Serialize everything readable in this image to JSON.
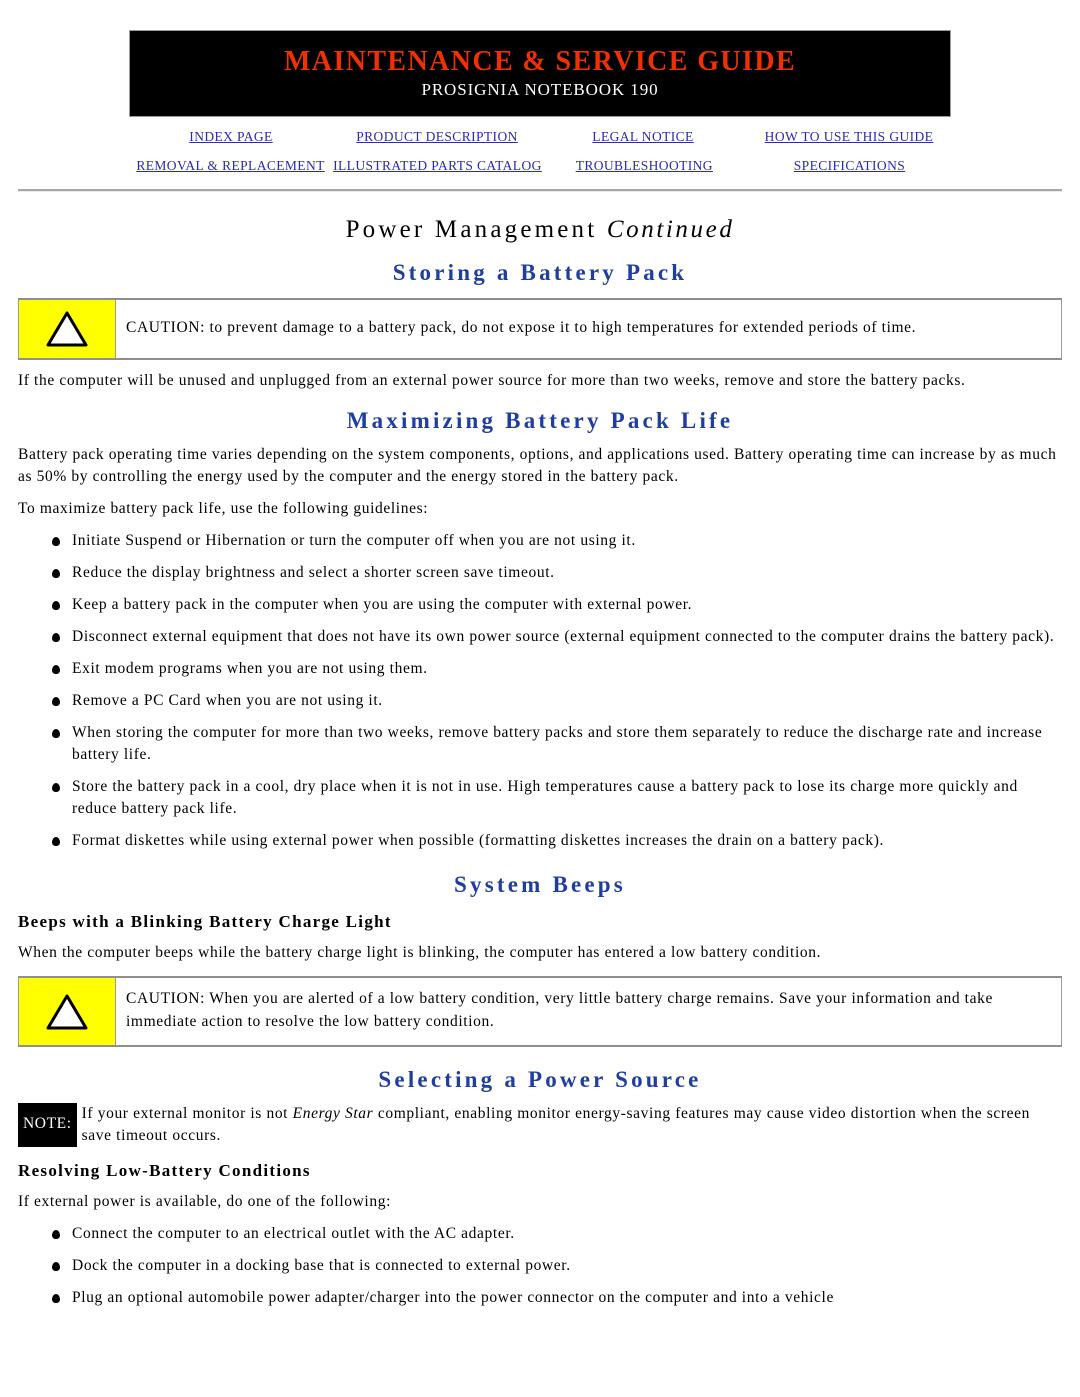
{
  "banner": {
    "title": "MAINTENANCE & SERVICE GUIDE",
    "subtitle": "PROSIGNIA NOTEBOOK 190",
    "title_color": "#ef3000",
    "background_color": "#000000"
  },
  "nav": {
    "row1": [
      {
        "label": "INDEX PAGE"
      },
      {
        "label": "PRODUCT DESCRIPTION"
      },
      {
        "label": "LEGAL NOTICE"
      },
      {
        "label": "HOW TO USE THIS GUIDE"
      }
    ],
    "row2": [
      {
        "label": "REMOVAL & REPLACEMENT"
      },
      {
        "label": "ILLUSTRATED PARTS CATALOG"
      },
      {
        "label": "TROUBLESHOOTING"
      },
      {
        "label": "SPECIFICATIONS"
      }
    ],
    "link_color": "#2a2ab0"
  },
  "page": {
    "title_main": "Power Management ",
    "title_italic": "Continued",
    "heading_color": "#1f3f9f"
  },
  "sections": {
    "storing": {
      "heading": "Storing a Battery Pack",
      "caution": {
        "icon": "warning-triangle-icon",
        "icon_bg": "#ffff00",
        "text": "CAUTION: to prevent damage to a battery pack, do not expose it to high temperatures for extended periods of time."
      },
      "paragraph": "If the computer will be unused and unplugged from an external power source for more than two weeks, remove and store the battery packs."
    },
    "maximizing": {
      "heading": "Maximizing Battery Pack Life",
      "paragraph1": "Battery pack operating time varies depending on the system components, options, and applications used. Battery operating time can increase by as much as 50% by controlling the energy used by the computer and the energy stored in the battery pack.",
      "paragraph2": "To maximize battery pack life, use the following guidelines:",
      "bullets": [
        "Initiate Suspend or Hibernation or turn the computer off when you are not using it.",
        "Reduce the display brightness and select a shorter screen save timeout.",
        "Keep a battery pack in the computer when you are using the computer with external power.",
        "Disconnect external equipment that does not have its own power source (external equipment connected to the computer drains the battery pack).",
        "Exit modem programs when you are not using them.",
        "Remove a PC Card when you are not using it.",
        "When storing the computer for more than two weeks, remove battery packs and store them separately to reduce the discharge rate and increase battery life.",
        "Store the battery pack in a cool, dry place when it is not in use. High temperatures cause a battery pack to lose its charge more quickly and reduce battery pack life.",
        "Format diskettes while using external power when possible (formatting diskettes increases the drain on a battery pack)."
      ]
    },
    "system_beeps": {
      "heading": "System Beeps",
      "subheading": "Beeps with a Blinking Battery Charge Light",
      "paragraph": "When the computer beeps while the battery charge light is blinking, the computer has entered a low battery condition.",
      "caution": {
        "icon": "warning-triangle-icon",
        "icon_bg": "#ffff00",
        "text": "CAUTION:  When you are alerted of a low battery condition, very little battery charge remains. Save your information and take immediate action to resolve the low battery condition."
      }
    },
    "selecting_power": {
      "heading": "Selecting a Power Source",
      "note": {
        "tag": "NOTE:",
        "text_before": "If your external monitor is not ",
        "text_italic": "Energy Star",
        "text_after": " compliant, enabling monitor energy-saving features may cause video distortion when the screen save timeout occurs."
      },
      "subheading": "Resolving Low-Battery Conditions",
      "paragraph": "If external power is available, do one of the following:",
      "bullets": [
        "Connect the computer to an electrical outlet with the AC adapter.",
        "Dock the computer in a docking base that is connected to external power.",
        "Plug an optional automobile power adapter/charger into the power connector on the computer and into a vehicle"
      ]
    }
  }
}
